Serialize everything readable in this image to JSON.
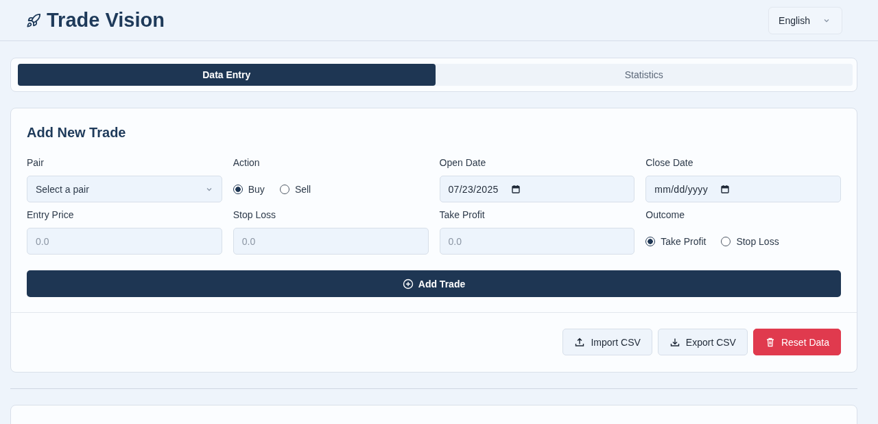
{
  "header": {
    "title": "Trade Vision",
    "language": "English"
  },
  "tabs": [
    {
      "label": "Data Entry",
      "selected": true
    },
    {
      "label": "Statistics",
      "selected": false
    }
  ],
  "form": {
    "title": "Add New Trade",
    "fields": [
      {
        "kind": "select",
        "label": "Pair",
        "placeholder": "Select a pair"
      },
      {
        "kind": "radio",
        "label": "Action",
        "options": [
          {
            "label": "Buy",
            "selected": true
          },
          {
            "label": "Sell",
            "selected": false
          }
        ]
      },
      {
        "kind": "date",
        "label": "Open Date",
        "value": "07/23/2025"
      },
      {
        "kind": "date",
        "label": "Close Date",
        "value": "mm/dd/yyyy"
      },
      {
        "kind": "number",
        "label": "Entry Price",
        "placeholder": "0.0"
      },
      {
        "kind": "number",
        "label": "Stop Loss",
        "placeholder": "0.0"
      },
      {
        "kind": "number",
        "label": "Take Profit",
        "placeholder": "0.0"
      },
      {
        "kind": "radio",
        "label": "Outcome",
        "options": [
          {
            "label": "Take Profit",
            "selected": true
          },
          {
            "label": "Stop Loss",
            "selected": false
          }
        ]
      }
    ],
    "submit": "Add Trade"
  },
  "actions": [
    {
      "kind": "import",
      "label": "Import CSV"
    },
    {
      "kind": "export",
      "label": "Export CSV"
    },
    {
      "kind": "reset",
      "label": "Reset Data"
    }
  ]
}
